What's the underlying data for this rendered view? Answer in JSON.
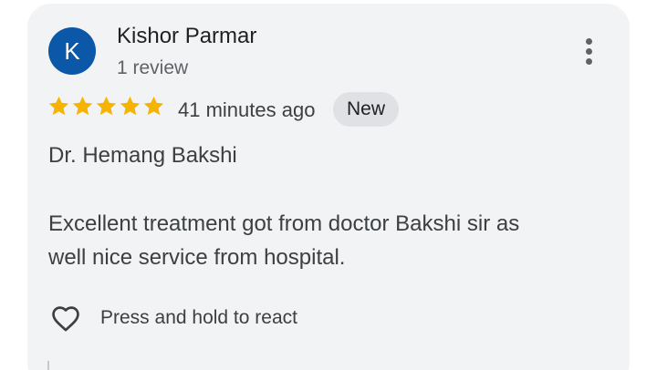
{
  "review": {
    "author": {
      "initial": "K",
      "name": "Kishor Parmar",
      "review_count": "1 review",
      "avatar_color": "#0b57a8"
    },
    "rating": {
      "stars": 5,
      "max": 5,
      "star_color": "#f6b400"
    },
    "time_ago": "41 minutes ago",
    "badge": "New",
    "text_lines": [
      "Dr. Hemang Bakshi",
      "Excellent treatment got from doctor Bakshi sir as",
      "well nice service from hospital."
    ],
    "react": {
      "icon": "heart-outline-icon",
      "label": "Press and hold to react"
    },
    "menu_icon": "more-vert-icon"
  }
}
